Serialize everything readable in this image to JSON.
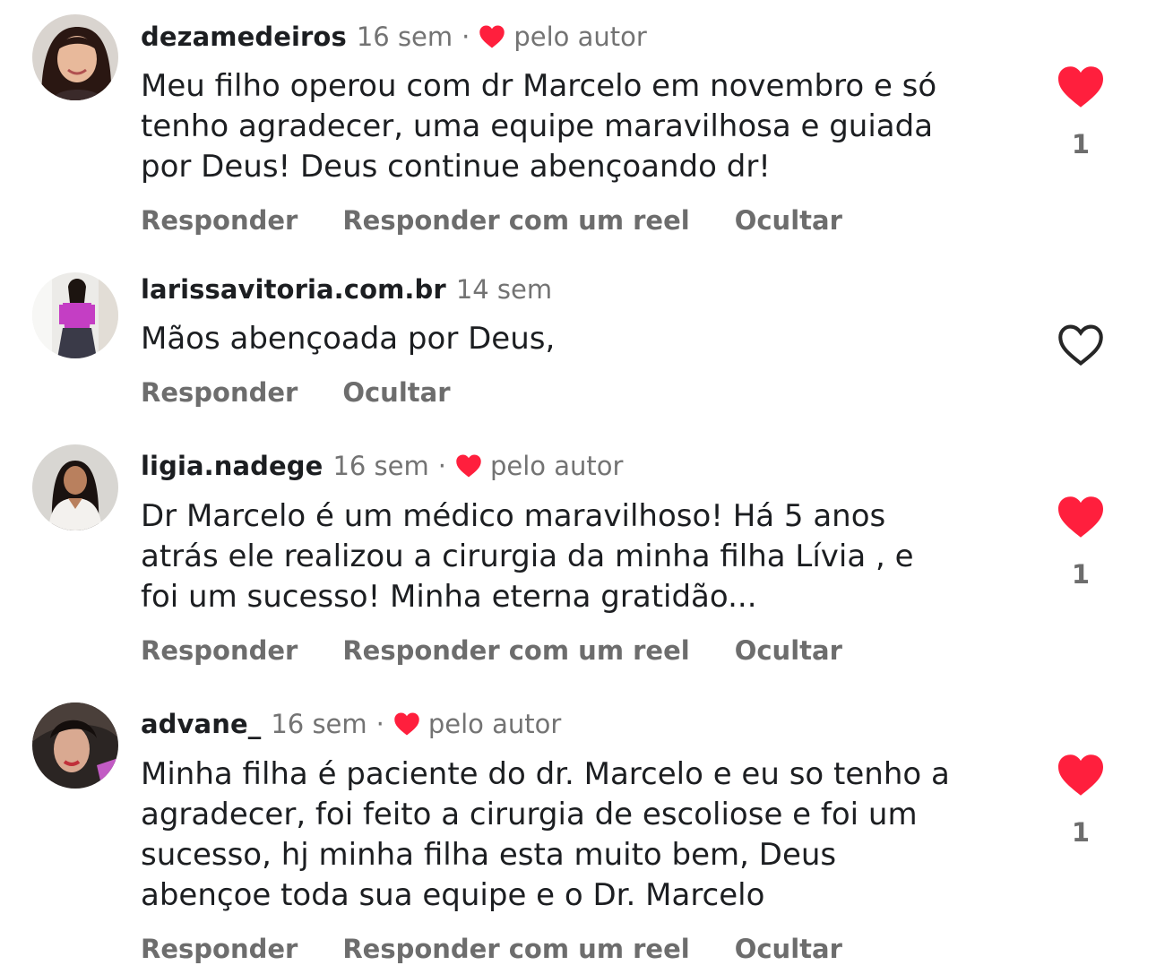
{
  "colors": {
    "heart_red": "#ff1f3d",
    "muted": "#737373",
    "text": "#1c1e21"
  },
  "icons": {
    "liked": "heart-filled-icon",
    "unliked": "heart-outline-icon",
    "author": "heart-filled-icon"
  },
  "actions": {
    "reply": "Responder",
    "reply_reel": "Responder com um reel",
    "hide": "Ocultar"
  },
  "comments": [
    {
      "username": "dezamedeiros",
      "time": "16 sem",
      "separator": "·",
      "by_author": "pelo autor",
      "text": "Meu filho operou com dr Marcelo em novembro e só\ntenho agradecer, uma equipe maravilhosa e guiada\npor Deus! Deus continue abençoando dr!",
      "liked": true,
      "like_count": "1"
    },
    {
      "username": "larissavitoria.com.br",
      "time": "14 sem",
      "text": "Mãos abençoada por Deus,",
      "liked": false
    },
    {
      "username": "ligia.nadege",
      "time": "16 sem",
      "separator": "·",
      "by_author": "pelo autor",
      "text": "Dr Marcelo é um médico maravilhoso! Há 5 anos\natrás  ele realizou a cirurgia da minha filha Lívia , e\nfoi um sucesso! Minha eterna gratidão...",
      "liked": true,
      "like_count": "1"
    },
    {
      "username": "advane_",
      "time": "16 sem",
      "separator": "·",
      "by_author": "pelo autor",
      "text": "Minha filha é paciente do dr. Marcelo e eu so tenho a\nagradecer, foi feito a cirurgia de escoliose e foi um\nsucesso, hj minha filha esta muito bem, Deus\nabençoe toda sua equipe e o Dr. Marcelo",
      "liked": true,
      "like_count": "1"
    }
  ]
}
